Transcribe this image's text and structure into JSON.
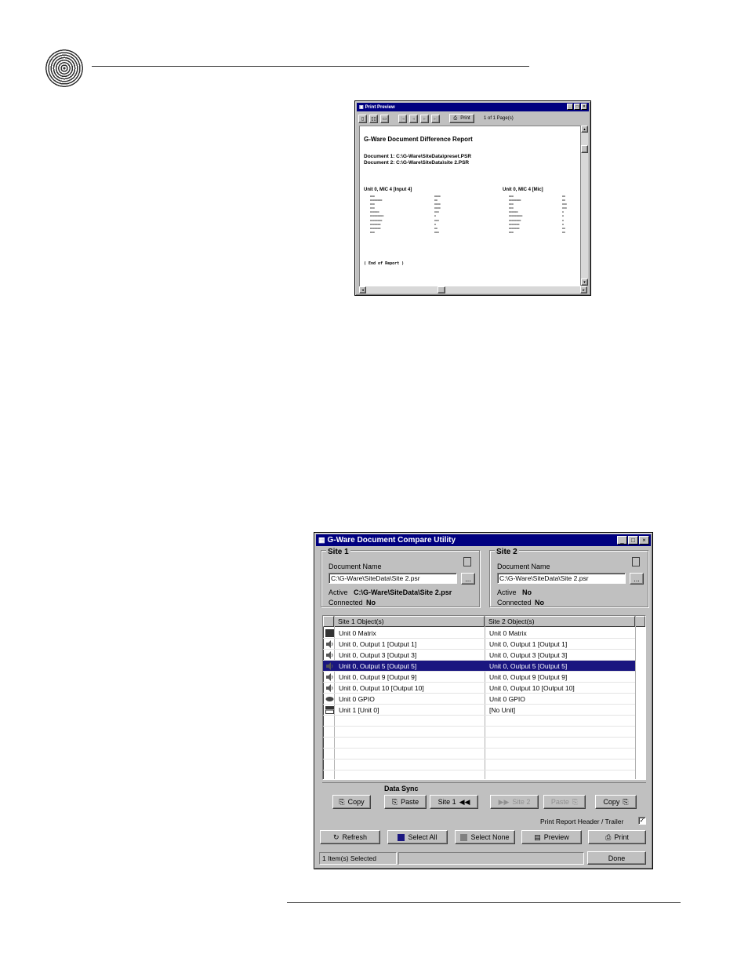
{
  "print_preview": {
    "title": "Print Preview",
    "print_label": "Print",
    "page_indicator": "1 of 1 Page(s)",
    "report_title": "G-Ware Document Difference Report",
    "doc1": "Document 1: C:\\G-Ware\\SiteData\\preset.PSR",
    "doc2": "Document 2: C:\\G-Ware\\SiteData\\site 2.PSR",
    "left_section": "Unit 0, MIC 4 [Input 4]",
    "right_section": "Unit 0, MIC 4 [Mic]",
    "end_text": "( End of Report )"
  },
  "utility": {
    "title": "G-Ware Document Compare Utility",
    "site1": {
      "legend": "Site 1",
      "doc_name_label": "Document Name",
      "path": "C:\\G-Ware\\SiteData\\Site 2.psr",
      "browse": "...",
      "active_label": "Active",
      "active_value": "C:\\G-Ware\\SiteData\\Site 2.psr",
      "connected_label": "Connected",
      "connected_value": "No"
    },
    "site2": {
      "legend": "Site 2",
      "doc_name_label": "Document Name",
      "path": "C:\\G-Ware\\SiteData\\Site 2.psr",
      "browse": "...",
      "active_label": "Active",
      "active_value": "No",
      "connected_label": "Connected",
      "connected_value": "No"
    },
    "columns": [
      "Site 1 Object(s)",
      "Site 2 Object(s)"
    ],
    "rows": [
      {
        "icon": "matrix-icon",
        "c1": "Unit 0 Matrix",
        "c2": "Unit 0 Matrix"
      },
      {
        "icon": "speaker-icon",
        "c1": "Unit 0, Output 1 [Output 1]",
        "c2": "Unit 0, Output 1 [Output 1]"
      },
      {
        "icon": "speaker-icon",
        "c1": "Unit 0, Output 3 [Output 3]",
        "c2": "Unit 0, Output 3 [Output 3]"
      },
      {
        "icon": "speaker-icon",
        "c1": "Unit 0, Output 5 [Output 5]",
        "c2": "Unit 0, Output 5 [Output 5]"
      },
      {
        "icon": "speaker-icon",
        "c1": "Unit 0, Output 9 [Output 9]",
        "c2": "Unit 0, Output 9 [Output 9]"
      },
      {
        "icon": "speaker-icon",
        "c1": "Unit 0, Output 10 [Output 10]",
        "c2": "Unit 0, Output 10 [Output 10]"
      },
      {
        "icon": "gpio-icon",
        "c1": "Unit 0 GPIO",
        "c2": "Unit 0 GPIO"
      },
      {
        "icon": "unit-icon",
        "c1": "Unit 1 [Unit 0]",
        "c2": "[No Unit]"
      }
    ],
    "data_sync_label": "Data Sync",
    "copy_left": "Copy",
    "paste_left": "Paste",
    "site1_nav": "Site 1",
    "site2_nav": "Site 2",
    "paste_right": "Paste",
    "copy_right": "Copy",
    "print_header_label": "Print Report Header / Trailer",
    "refresh": "Refresh",
    "select_all": "Select All",
    "select_none": "Select None",
    "preview": "Preview",
    "print": "Print",
    "status": "1 Item(s) Selected",
    "done": "Done"
  }
}
